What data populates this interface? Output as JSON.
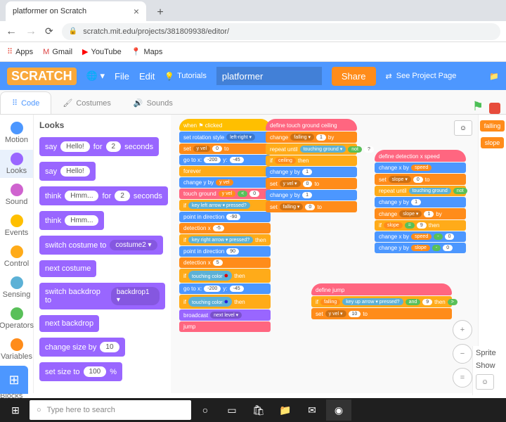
{
  "browser": {
    "tab_title": "platformer on Scratch",
    "url": "scratch.mit.edu/projects/381809938/editor/",
    "bookmarks": [
      "Apps",
      "Gmail",
      "YouTube",
      "Maps"
    ]
  },
  "header": {
    "logo": "SCRATCH",
    "file": "File",
    "edit": "Edit",
    "tutorials": "Tutorials",
    "project_name": "platformer",
    "share": "Share",
    "see_page": "See Project Page"
  },
  "tabs": {
    "code": "Code",
    "costumes": "Costumes",
    "sounds": "Sounds"
  },
  "categories": [
    {
      "name": "Motion",
      "color": "#4c97ff"
    },
    {
      "name": "Looks",
      "color": "#9966ff"
    },
    {
      "name": "Sound",
      "color": "#cf63cf"
    },
    {
      "name": "Events",
      "color": "#ffbf00"
    },
    {
      "name": "Control",
      "color": "#ffab19"
    },
    {
      "name": "Sensing",
      "color": "#5cb1d6"
    },
    {
      "name": "Operators",
      "color": "#59c059"
    },
    {
      "name": "Variables",
      "color": "#ff8c1a"
    },
    {
      "name": "My Blocks",
      "color": "#ff6680"
    }
  ],
  "palette": {
    "title": "Looks",
    "blocks": [
      {
        "t": "say",
        "a": "Hello!",
        "b": "for",
        "c": "2",
        "d": "seconds"
      },
      {
        "t": "say",
        "a": "Hello!"
      },
      {
        "t": "think",
        "a": "Hmm...",
        "b": "for",
        "c": "2",
        "d": "seconds"
      },
      {
        "t": "think",
        "a": "Hmm..."
      },
      {
        "t": "switch costume to",
        "dd": "costume2 ▾"
      },
      {
        "t": "next costume"
      },
      {
        "t": "switch backdrop to",
        "dd": "backdrop1 ▾"
      },
      {
        "t": "next backdrop"
      },
      {
        "t": "change size by",
        "a": "10"
      },
      {
        "t": "set size to",
        "a": "100",
        "b": "%"
      }
    ]
  },
  "scripts": {
    "s1": {
      "hat": "when ⚑ clicked",
      "rows": [
        {
          "c": "mo",
          "t": "set rotation style",
          "d": "left-right ▾"
        },
        {
          "c": "va",
          "t": "set",
          "d": "y vel",
          "t2": "to",
          "p": "0"
        },
        {
          "c": "mo",
          "t": "go to x:",
          "p": "-200",
          "t2": "y:",
          "p2": "-45"
        },
        {
          "c": "co",
          "t": "forever"
        },
        {
          "c": "mo",
          "t": "change y by",
          "v": "y vel"
        },
        {
          "c": "my",
          "t": "touch ground",
          "v": "y vel",
          "op": "<",
          "p": "0"
        },
        {
          "c": "co",
          "t": "if",
          "se": "key left arrow ▾ pressed?"
        },
        {
          "c": "mo",
          "t": "point in direction",
          "p": "-90"
        },
        {
          "c": "va",
          "t": "detection x",
          "p": "-5"
        },
        {
          "c": "co",
          "t": "if",
          "se": "key right arrow ▾ pressed?",
          "t2": "then"
        },
        {
          "c": "mo",
          "t": "point in direction",
          "p": "90"
        },
        {
          "c": "va",
          "t": "detection x",
          "p": "5"
        },
        {
          "c": "co",
          "t": "if",
          "se": "touching color ●",
          "t2": "then",
          "col": "#d00"
        },
        {
          "c": "mo",
          "t": "go to x:",
          "p": "-200",
          "t2": "y:",
          "p2": "-45"
        },
        {
          "c": "co",
          "t": "if",
          "se": "touching color ●",
          "t2": "then",
          "col": "#22d"
        },
        {
          "c": "lo",
          "t": "broadcast",
          "d": "next level ▾"
        },
        {
          "c": "my",
          "t": "jump"
        }
      ]
    },
    "s2": {
      "hat": "define touch ground ceiling",
      "rows": [
        {
          "c": "va",
          "t": "change",
          "d": "falling ▾",
          "t2": "by",
          "p": "1"
        },
        {
          "c": "co",
          "t": "repeat until",
          "op": "not",
          "se": "touching ground ▾",
          "p": "?"
        },
        {
          "c": "co",
          "t": "if",
          "v": "ceiling",
          "t2": "then"
        },
        {
          "c": "mo",
          "t": "change y by",
          "p": "1"
        },
        {
          "c": "va",
          "t": "set",
          "d": "y vel ▾",
          "t2": "to",
          "p": "0"
        },
        {
          "c": "mo",
          "t": "change y by",
          "p": "1"
        },
        {
          "c": "va",
          "t": "set",
          "d": "falling ▾",
          "t2": "to",
          "p": "0"
        }
      ]
    },
    "s3": {
      "hat": "define detection x speed",
      "rows": [
        {
          "c": "mo",
          "t": "change x by",
          "v": "speed"
        },
        {
          "c": "va",
          "t": "set",
          "d": "slope ▾",
          "t2": "to",
          "p": "0"
        },
        {
          "c": "co",
          "t": "repeat until",
          "op": "not",
          "se": "touching ground"
        },
        {
          "c": "mo",
          "t": "change y by",
          "p": "1"
        },
        {
          "c": "va",
          "t": "change",
          "d": "slope ▾",
          "t2": "by",
          "p": "1"
        },
        {
          "c": "co",
          "t": "if",
          "v": "slope",
          "op": "=",
          "p": "9",
          "t2": "then"
        },
        {
          "c": "mo",
          "t": "change x by",
          "p": "0",
          "op": "-",
          "v": "speed"
        },
        {
          "c": "mo",
          "t": "change y by",
          "p": "0",
          "op": "-",
          "v": "slope"
        }
      ]
    },
    "s4": {
      "hat": "define jump",
      "rows": [
        {
          "c": "co",
          "t": "if",
          "se": "key up arrow ▾ pressed?",
          "op": "and",
          "p": "9",
          "op2": ">",
          "v": "falling",
          "t2": "then"
        },
        {
          "c": "va",
          "t": "set",
          "d": "y vel ▾",
          "t2": "to",
          "p": "10"
        }
      ]
    }
  },
  "right": {
    "vars": [
      "falling",
      "slope"
    ],
    "sprite": "Sprite",
    "show": "Show"
  },
  "taskbar": {
    "search": "Type here to search"
  }
}
